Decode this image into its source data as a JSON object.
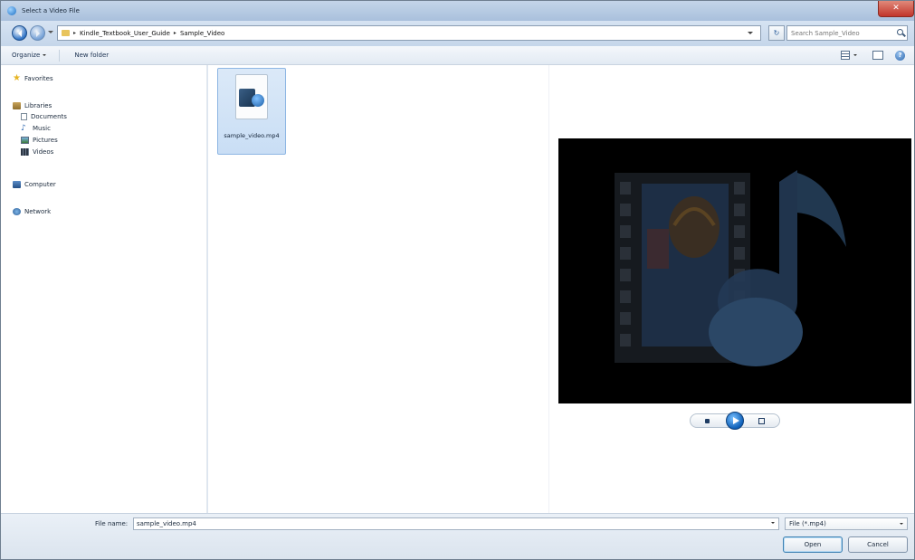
{
  "window": {
    "title": "Select a Video File"
  },
  "address": {
    "crumbs": [
      "Kindle_Textbook_User_Guide",
      "Sample_Video"
    ],
    "separator": "▸",
    "search_placeholder": "Search Sample_Video"
  },
  "toolbar": {
    "organize_label": "Organize",
    "new_folder_label": "New folder"
  },
  "nav": {
    "favorites": "Favorites",
    "libraries": "Libraries",
    "documents": "Documents",
    "music": "Music",
    "pictures": "Pictures",
    "videos": "Videos",
    "computer": "Computer",
    "network": "Network"
  },
  "files": [
    {
      "name": "sample_video.mp4"
    }
  ],
  "footer": {
    "filename_label": "File name:",
    "filename_value": "sample_video.mp4",
    "filter_label": "File (*.mp4)",
    "open_label": "Open",
    "cancel_label": "Cancel"
  },
  "colors": {
    "title_bar": "#b8cce4",
    "selection": "#cfe2f7",
    "close": "#c2352b",
    "play": "#0d5fb8"
  },
  "icons": {
    "close": "close-icon",
    "back": "back-arrow-icon",
    "search": "search-icon",
    "help": "help-icon",
    "folder": "folder-icon",
    "video_file": "video-file-icon"
  }
}
